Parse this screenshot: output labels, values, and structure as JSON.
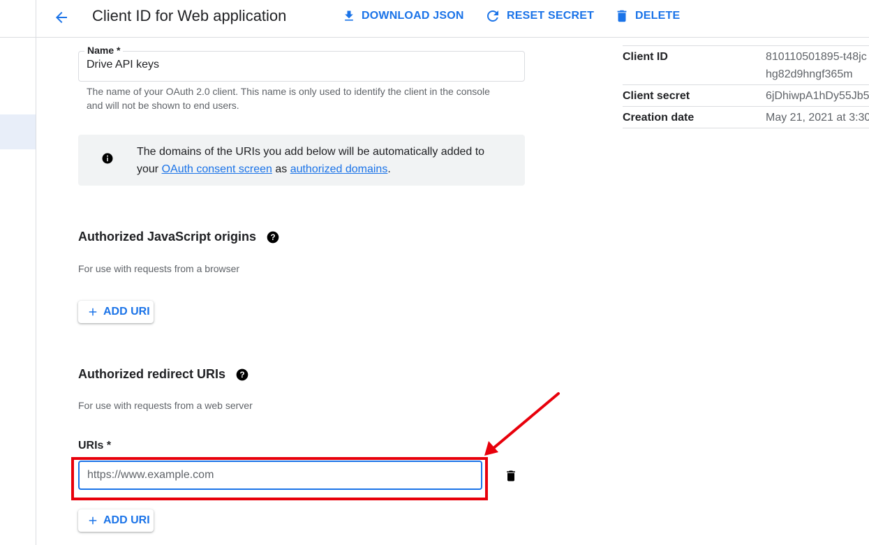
{
  "header": {
    "title": "Client ID for Web application",
    "actions": {
      "download": "DOWNLOAD JSON",
      "reset": "RESET SECRET",
      "delete": "DELETE"
    }
  },
  "form": {
    "name_label": "Name *",
    "name_value": "Drive API keys",
    "name_hint": "The name of your OAuth 2.0 client. This name is only used to identify the client in the console and will not be shown to end users.",
    "info": {
      "text_before": "The domains of the URIs you add below will be automatically added to your ",
      "link1": "OAuth consent screen",
      "text_mid": " as ",
      "link2": "authorized domains",
      "text_after": "."
    },
    "js_origins": {
      "title": "Authorized JavaScript origins",
      "subtitle": "For use with requests from a browser",
      "add_label": "ADD URI"
    },
    "redirect_uris": {
      "title": "Authorized redirect URIs",
      "subtitle": "For use with requests from a web server",
      "uris_label": "URIs *",
      "placeholder": "https://www.example.com",
      "add_label": "ADD URI"
    }
  },
  "meta": {
    "client_id_label": "Client ID",
    "client_id_value": "810110501895-t48jchg82d9hngf365m",
    "client_secret_label": "Client secret",
    "client_secret_value": "6jDhiwpA1hDy55Jb5",
    "creation_date_label": "Creation date",
    "creation_date_value": "May 21, 2021 at 3:30"
  },
  "colors": {
    "accent": "#1a73e8",
    "annotation": "#e8000b"
  }
}
